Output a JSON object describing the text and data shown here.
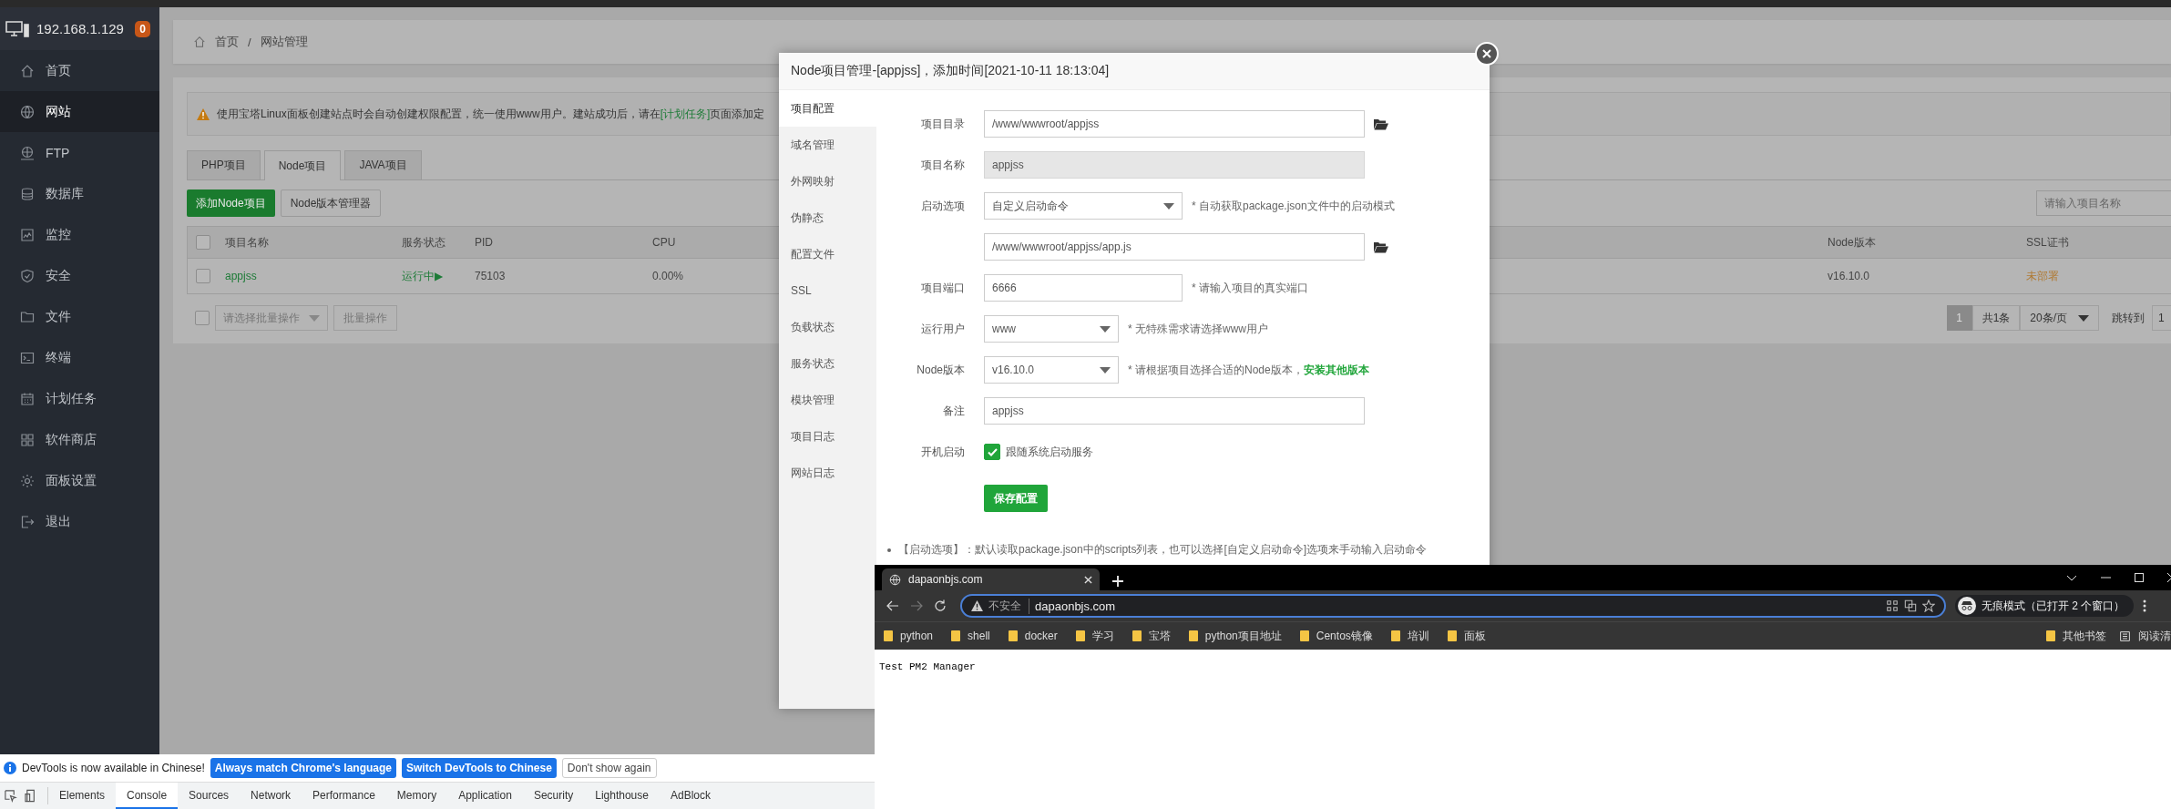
{
  "sidebar": {
    "host": "192.168.1.129",
    "badge": "0",
    "items": [
      {
        "label": "首页",
        "selected": false
      },
      {
        "label": "网站",
        "selected": true
      },
      {
        "label": "FTP",
        "selected": false
      },
      {
        "label": "数据库",
        "selected": false
      },
      {
        "label": "监控",
        "selected": false
      },
      {
        "label": "安全",
        "selected": false
      },
      {
        "label": "文件",
        "selected": false
      },
      {
        "label": "终端",
        "selected": false
      },
      {
        "label": "计划任务",
        "selected": false
      },
      {
        "label": "软件商店",
        "selected": false
      },
      {
        "label": "面板设置",
        "selected": false
      },
      {
        "label": "退出",
        "selected": false
      }
    ]
  },
  "breadcrumb": {
    "items": [
      "首页",
      "网站管理"
    ],
    "separator": "/"
  },
  "notice": {
    "text": "使用宝塔Linux面板创建站点时会自动创建权限配置，统一使用www用户。建站成功后，请在",
    "link": "[计划任务]",
    "text_after": "页面添加定"
  },
  "project_tabs": [
    {
      "label": "PHP项目",
      "selected": false
    },
    {
      "label": "Node项目",
      "selected": true
    },
    {
      "label": "JAVA项目",
      "selected": false
    }
  ],
  "toolbar": {
    "buttons": [
      "添加Node项目",
      "Node版本管理器"
    ],
    "search_placeholder": "请输入项目名称"
  },
  "table": {
    "header_checked": false,
    "columns": [
      "项目名称",
      "服务状态",
      "PID",
      "CPU",
      "Node版本",
      "SSL证书"
    ],
    "rows": [
      {
        "checked": false,
        "name": "appjss",
        "status": "运行中",
        "status_mark": "▶",
        "pid": "75103",
        "cpu": "0.00%",
        "node_version": "v16.10.0",
        "ssl": "未部署"
      }
    ]
  },
  "batch": {
    "checked": false,
    "select_placeholder": "请选择批量操作",
    "button": "批量操作"
  },
  "pagination": {
    "current": "1",
    "total": "共1条",
    "per_page": "20条/页",
    "jump_label": "跳转到",
    "jump_value": "1"
  },
  "modal": {
    "title": "Node项目管理-[appjss]，添加时间[2021-10-11 18:13:04]",
    "nav": [
      {
        "label": "项目配置",
        "selected": true
      },
      {
        "label": "域名管理",
        "selected": false
      },
      {
        "label": "外网映射",
        "selected": false
      },
      {
        "label": "伪静态",
        "selected": false
      },
      {
        "label": "配置文件",
        "selected": false
      },
      {
        "label": "SSL",
        "selected": false
      },
      {
        "label": "负载状态",
        "selected": false
      },
      {
        "label": "服务状态",
        "selected": false
      },
      {
        "label": "模块管理",
        "selected": false
      },
      {
        "label": "项目日志",
        "selected": false
      },
      {
        "label": "网站日志",
        "selected": false
      }
    ],
    "form": [
      {
        "kind": "input",
        "label": "项目目录",
        "value": "/www/wwwroot/appjss",
        "disabled": false,
        "browse": true
      },
      {
        "kind": "input",
        "label": "项目名称",
        "value": "appjss",
        "disabled": true,
        "browse": false
      },
      {
        "kind": "select",
        "label": "启动选项",
        "value": "自定义启动命令",
        "hint": "* 自动获取package.json文件中的启动模式"
      },
      {
        "kind": "input",
        "value": "/www/wwwroot/appjss/app.js",
        "disabled": false,
        "browse": true
      },
      {
        "kind": "input",
        "label": "项目端口",
        "value": "6666",
        "disabled": false,
        "browse": false,
        "hint": "* 请输入项目的真实端口"
      },
      {
        "kind": "select",
        "label": "运行用户",
        "value": "www",
        "hint": "* 无特殊需求请选择www用户"
      },
      {
        "kind": "select",
        "label": "Node版本",
        "value": "v16.10.0",
        "hint": "* 请根据项目选择合适的Node版本，",
        "hint_link": "安装其他版本"
      },
      {
        "kind": "input",
        "label": "备注",
        "value": "appjss",
        "disabled": false,
        "browse": false
      },
      {
        "kind": "checkbox",
        "label": "开机启动",
        "checked": true,
        "text": "跟随系统启动服务"
      }
    ],
    "save": "保存配置",
    "note": "【启动选项】：默认读取package.json中的scripts列表，也可以选择[自定义启动命令]选项来手动输入启动命令"
  },
  "browser": {
    "tab_title": "dapaonbjs.com",
    "security": "不安全",
    "url": "dapaonbjs.com",
    "profile": "无痕模式（已打开 2 个窗口）",
    "bookmarks": [
      "python",
      "shell",
      "docker",
      "学习",
      "宝塔",
      "python项目地址",
      "Centos镜像",
      "培训",
      "面板"
    ],
    "bookmarks_right": [
      "其他书签",
      "阅读清"
    ],
    "content": "Test PM2 Manager"
  },
  "devtools": {
    "notice": "DevTools is now available in Chinese!",
    "actions": [
      {
        "label": "Always match Chrome's language",
        "kind": "primary"
      },
      {
        "label": "Switch DevTools to Chinese",
        "kind": "primary"
      },
      {
        "label": "Don't show again",
        "kind": "plain"
      }
    ],
    "tabs": [
      {
        "label": "Elements",
        "selected": false
      },
      {
        "label": "Console",
        "selected": true
      },
      {
        "label": "Sources",
        "selected": false
      },
      {
        "label": "Network",
        "selected": false
      },
      {
        "label": "Performance",
        "selected": false
      },
      {
        "label": "Memory",
        "selected": false
      },
      {
        "label": "Application",
        "selected": false
      },
      {
        "label": "Security",
        "selected": false
      },
      {
        "label": "Lighthouse",
        "selected": false
      },
      {
        "label": "AdBlock",
        "selected": false
      }
    ]
  }
}
